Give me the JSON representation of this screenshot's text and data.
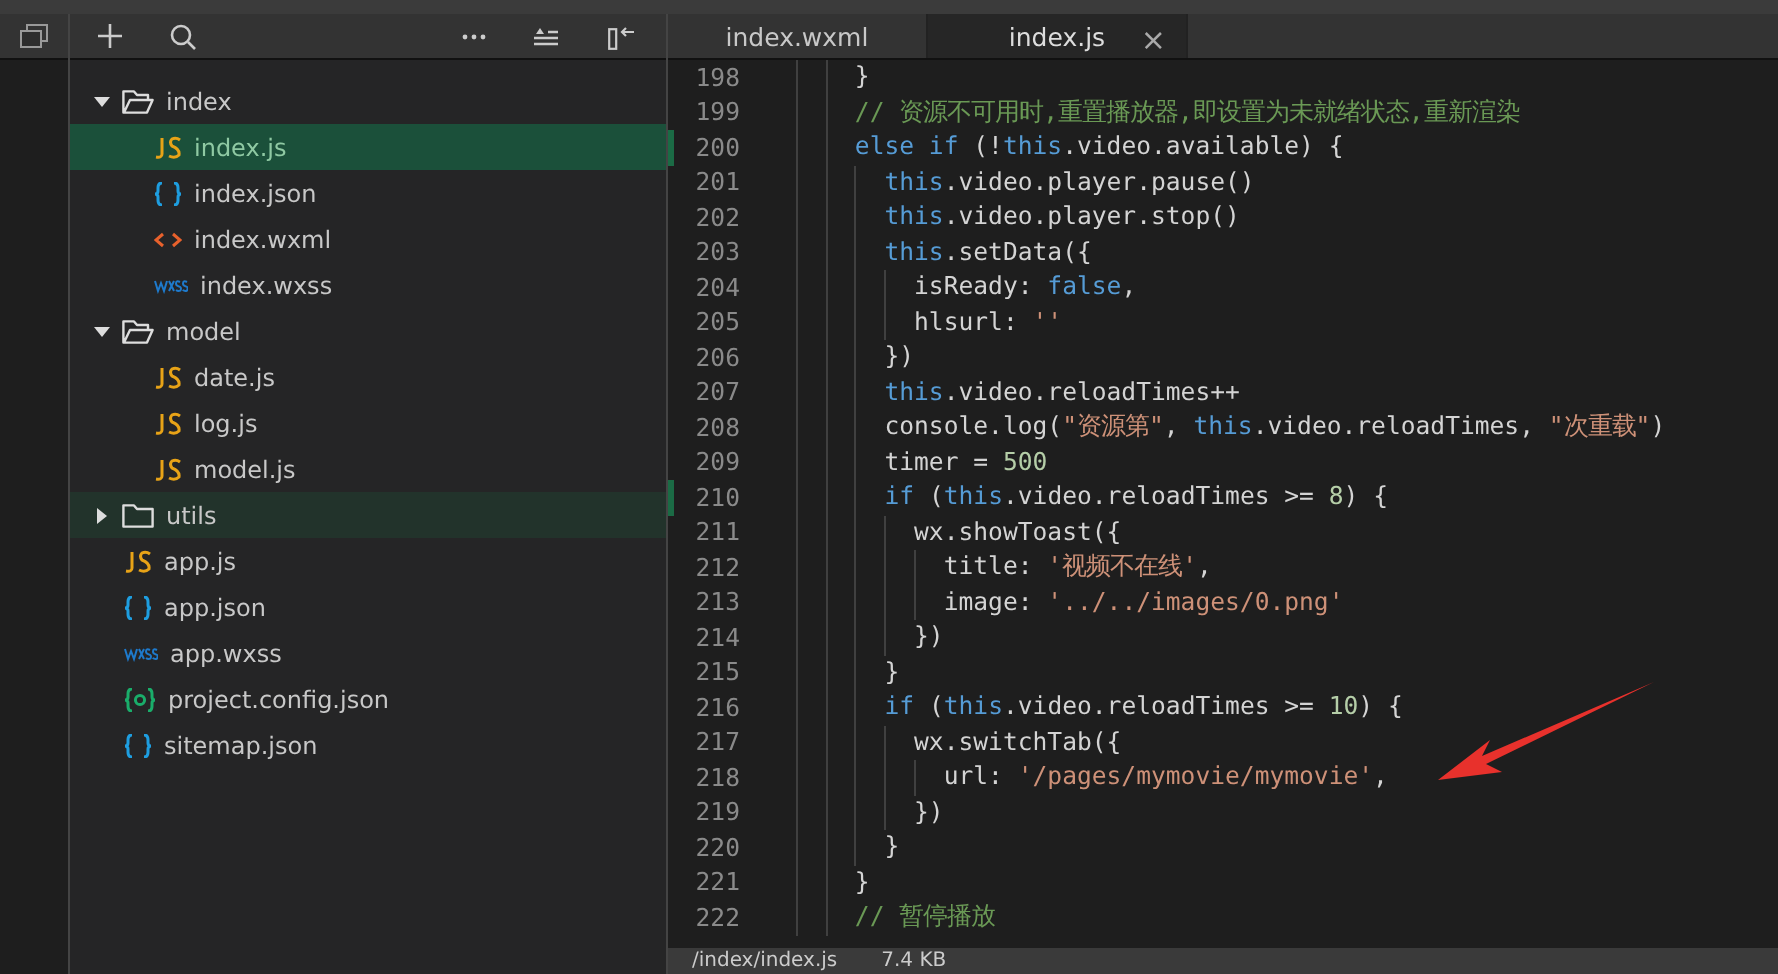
{
  "tree": [
    {
      "kind": "folder",
      "label": "index",
      "expanded": true,
      "selected": false,
      "hovered": false,
      "children": [
        {
          "kind": "js",
          "label": "index.js",
          "selected": true,
          "hovered": false
        },
        {
          "kind": "json",
          "label": "index.json",
          "selected": false,
          "hovered": false
        },
        {
          "kind": "wxml",
          "label": "index.wxml",
          "selected": false,
          "hovered": false
        },
        {
          "kind": "wxss",
          "label": "index.wxss",
          "selected": false,
          "hovered": false
        }
      ]
    },
    {
      "kind": "folder",
      "label": "model",
      "expanded": true,
      "selected": false,
      "hovered": false,
      "children": [
        {
          "kind": "js",
          "label": "date.js",
          "selected": false,
          "hovered": false
        },
        {
          "kind": "js",
          "label": "log.js",
          "selected": false,
          "hovered": false
        },
        {
          "kind": "js",
          "label": "model.js",
          "selected": false,
          "hovered": false
        }
      ]
    },
    {
      "kind": "folder",
      "label": "utils",
      "expanded": false,
      "selected": false,
      "hovered": true
    },
    {
      "kind": "js",
      "label": "app.js",
      "selected": false,
      "hovered": false
    },
    {
      "kind": "json",
      "label": "app.json",
      "selected": false,
      "hovered": false
    },
    {
      "kind": "wxss",
      "label": "app.wxss",
      "selected": false,
      "hovered": false
    },
    {
      "kind": "config",
      "label": "project.config.json",
      "selected": false,
      "hovered": false
    },
    {
      "kind": "json",
      "label": "sitemap.json",
      "selected": false,
      "hovered": false
    }
  ],
  "tabs": [
    {
      "label": "index.wxml",
      "selected": false
    },
    {
      "label": "index.js",
      "selected": true,
      "close": "×"
    }
  ],
  "code": [
    {
      "number": "198",
      "modified": false,
      "tokens": [
        {
          "kind": "plain",
          "text": "      }"
        }
      ]
    },
    {
      "number": "199",
      "modified": false,
      "tokens": [
        {
          "kind": "cmt",
          "text": "      // 资源不可用时,重置播放器,即设置为未就绪状态,重新渲染"
        }
      ]
    },
    {
      "number": "200",
      "modified": true,
      "tokens": [
        {
          "kind": "kw",
          "text": "      else if"
        },
        {
          "kind": "plain",
          "text": " (!"
        },
        {
          "kind": "kw",
          "text": "this"
        },
        {
          "kind": "plain",
          "text": ".video.available) {"
        }
      ]
    },
    {
      "number": "201",
      "modified": false,
      "tokens": [
        {
          "kind": "kw",
          "text": "        this"
        },
        {
          "kind": "plain",
          "text": ".video.player.pause()"
        }
      ]
    },
    {
      "number": "202",
      "modified": false,
      "tokens": [
        {
          "kind": "kw",
          "text": "        this"
        },
        {
          "kind": "plain",
          "text": ".video.player.stop()"
        }
      ]
    },
    {
      "number": "203",
      "modified": false,
      "tokens": [
        {
          "kind": "kw",
          "text": "        this"
        },
        {
          "kind": "plain",
          "text": ".setData({"
        }
      ]
    },
    {
      "number": "204",
      "modified": false,
      "tokens": [
        {
          "kind": "plain",
          "text": "          isReady: "
        },
        {
          "kind": "kw",
          "text": "false"
        },
        {
          "kind": "plain",
          "text": ","
        }
      ]
    },
    {
      "number": "205",
      "modified": false,
      "tokens": [
        {
          "kind": "plain",
          "text": "          hlsurl: "
        },
        {
          "kind": "str",
          "text": "''"
        }
      ]
    },
    {
      "number": "206",
      "modified": false,
      "tokens": [
        {
          "kind": "plain",
          "text": "        })"
        }
      ]
    },
    {
      "number": "207",
      "modified": false,
      "tokens": [
        {
          "kind": "kw",
          "text": "        this"
        },
        {
          "kind": "plain",
          "text": ".video.reloadTimes++"
        }
      ]
    },
    {
      "number": "208",
      "modified": false,
      "tokens": [
        {
          "kind": "plain",
          "text": "        console.log("
        },
        {
          "kind": "str",
          "text": "\"资源第\""
        },
        {
          "kind": "plain",
          "text": ", "
        },
        {
          "kind": "kw",
          "text": "this"
        },
        {
          "kind": "plain",
          "text": ".video.reloadTimes, "
        },
        {
          "kind": "str",
          "text": "\"次重载\""
        },
        {
          "kind": "plain",
          "text": ")"
        }
      ]
    },
    {
      "number": "209",
      "modified": false,
      "tokens": [
        {
          "kind": "plain",
          "text": "        timer = "
        },
        {
          "kind": "num",
          "text": "500"
        }
      ]
    },
    {
      "number": "210",
      "modified": true,
      "tokens": [
        {
          "kind": "kw",
          "text": "        if"
        },
        {
          "kind": "plain",
          "text": " ("
        },
        {
          "kind": "kw",
          "text": "this"
        },
        {
          "kind": "plain",
          "text": ".video.reloadTimes >= "
        },
        {
          "kind": "num",
          "text": "8"
        },
        {
          "kind": "plain",
          "text": ") {"
        }
      ]
    },
    {
      "number": "211",
      "modified": false,
      "tokens": [
        {
          "kind": "plain",
          "text": "          wx.showToast({"
        }
      ]
    },
    {
      "number": "212",
      "modified": false,
      "tokens": [
        {
          "kind": "plain",
          "text": "            title: "
        },
        {
          "kind": "str",
          "text": "'视频不在线'"
        },
        {
          "kind": "plain",
          "text": ","
        }
      ]
    },
    {
      "number": "213",
      "modified": false,
      "tokens": [
        {
          "kind": "plain",
          "text": "            image: "
        },
        {
          "kind": "str",
          "text": "'../../images/0.png'"
        }
      ]
    },
    {
      "number": "214",
      "modified": false,
      "tokens": [
        {
          "kind": "plain",
          "text": "          })"
        }
      ]
    },
    {
      "number": "215",
      "modified": false,
      "tokens": [
        {
          "kind": "plain",
          "text": "        }"
        }
      ]
    },
    {
      "number": "216",
      "modified": false,
      "tokens": [
        {
          "kind": "kw",
          "text": "        if"
        },
        {
          "kind": "plain",
          "text": " ("
        },
        {
          "kind": "kw",
          "text": "this"
        },
        {
          "kind": "plain",
          "text": ".video.reloadTimes >= "
        },
        {
          "kind": "num",
          "text": "10"
        },
        {
          "kind": "plain",
          "text": ") {"
        }
      ]
    },
    {
      "number": "217",
      "modified": false,
      "tokens": [
        {
          "kind": "plain",
          "text": "          wx.switchTab({"
        }
      ]
    },
    {
      "number": "218",
      "modified": false,
      "tokens": [
        {
          "kind": "plain",
          "text": "            url: "
        },
        {
          "kind": "str",
          "text": "'/pages/mymovie/mymovie'"
        },
        {
          "kind": "plain",
          "text": ","
        }
      ]
    },
    {
      "number": "219",
      "modified": false,
      "tokens": [
        {
          "kind": "plain",
          "text": "          })"
        }
      ]
    },
    {
      "number": "220",
      "modified": false,
      "tokens": [
        {
          "kind": "plain",
          "text": "        }"
        }
      ]
    },
    {
      "number": "221",
      "modified": false,
      "tokens": [
        {
          "kind": "plain",
          "text": "      }"
        }
      ]
    },
    {
      "number": "222",
      "modified": false,
      "tokens": [
        {
          "kind": "cmt",
          "text": "      // 暂停播放"
        }
      ]
    }
  ],
  "status_bar": {
    "path": "/index/index.js",
    "size": "7.4 KB"
  }
}
